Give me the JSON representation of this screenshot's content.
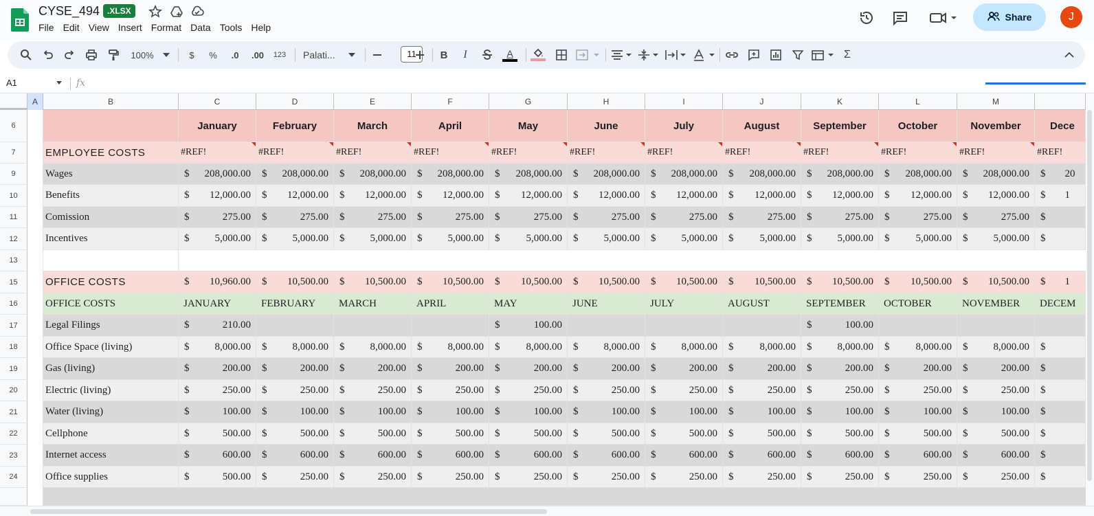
{
  "app": {
    "doc_title": "CYSE_494",
    "format_badge": ".XLSX",
    "menu": [
      "File",
      "Edit",
      "View",
      "Insert",
      "Format",
      "Data",
      "Tools",
      "Help"
    ],
    "share_label": "Share",
    "avatar_letter": "J",
    "accent_color": "#188038"
  },
  "toolbar": {
    "zoom": "100%",
    "currency": "$",
    "percent": "%",
    "dec_decrease": ".0",
    "dec_increase": ".00",
    "number_format": "123",
    "font": "Palati...",
    "font_size": "11",
    "bold": "B",
    "italic": "I",
    "text_color": "A",
    "sigma": "Σ"
  },
  "formula_bar": {
    "cell_ref": "A1",
    "fx": "fx"
  },
  "grid": {
    "columns": [
      "A",
      "B",
      "C",
      "D",
      "E",
      "F",
      "G",
      "H",
      "I",
      "J",
      "K",
      "L",
      "M"
    ],
    "rows": [
      {
        "num": "6",
        "type": "months",
        "label": "",
        "values": [
          "January",
          "February",
          "March",
          "April",
          "May",
          "June",
          "July",
          "August",
          "September",
          "October",
          "November",
          "Dece"
        ]
      },
      {
        "num": "7",
        "type": "ref",
        "label": "EMPLOYEE COSTS",
        "values": [
          "#REF!",
          "#REF!",
          "#REF!",
          "#REF!",
          "#REF!",
          "#REF!",
          "#REF!",
          "#REF!",
          "#REF!",
          "#REF!",
          "#REF!",
          "#REF!"
        ]
      },
      {
        "num": "9",
        "type": "money",
        "style": "gray",
        "label": "Wages",
        "values": [
          "208,000.00",
          "208,000.00",
          "208,000.00",
          "208,000.00",
          "208,000.00",
          "208,000.00",
          "208,000.00",
          "208,000.00",
          "208,000.00",
          "208,000.00",
          "208,000.00",
          "20"
        ]
      },
      {
        "num": "10",
        "type": "money",
        "style": "light",
        "label": "Benefits",
        "values": [
          "12,000.00",
          "12,000.00",
          "12,000.00",
          "12,000.00",
          "12,000.00",
          "12,000.00",
          "12,000.00",
          "12,000.00",
          "12,000.00",
          "12,000.00",
          "12,000.00",
          "1"
        ]
      },
      {
        "num": "11",
        "type": "money",
        "style": "gray",
        "label": "Comission",
        "values": [
          "275.00",
          "275.00",
          "275.00",
          "275.00",
          "275.00",
          "275.00",
          "275.00",
          "275.00",
          "275.00",
          "275.00",
          "275.00",
          ""
        ]
      },
      {
        "num": "12",
        "type": "money",
        "style": "light",
        "label": "Incentives",
        "values": [
          "5,000.00",
          "5,000.00",
          "5,000.00",
          "5,000.00",
          "5,000.00",
          "5,000.00",
          "5,000.00",
          "5,000.00",
          "5,000.00",
          "5,000.00",
          "5,000.00",
          ""
        ]
      },
      {
        "num": "13",
        "type": "blank",
        "label": "",
        "values": []
      },
      {
        "num": "15",
        "type": "money",
        "style": "pink",
        "label": "OFFICE COSTS",
        "values": [
          "10,960.00",
          "10,500.00",
          "10,500.00",
          "10,500.00",
          "10,500.00",
          "10,500.00",
          "10,500.00",
          "10,500.00",
          "10,500.00",
          "10,500.00",
          "10,500.00",
          "1"
        ]
      },
      {
        "num": "16",
        "type": "upper",
        "label": "OFFICE COSTS",
        "values": [
          "JANUARY",
          "FEBRUARY",
          "MARCH",
          "APRIL",
          "MAY",
          "JUNE",
          "JULY",
          "AUGUST",
          "SEPTEMBER",
          "OCTOBER",
          "NOVEMBER",
          "DECEM"
        ]
      },
      {
        "num": "17",
        "type": "money",
        "style": "gray",
        "label": "Legal Filings",
        "values": [
          "210.00",
          null,
          null,
          null,
          "100.00",
          null,
          null,
          null,
          "100.00",
          null,
          null,
          null
        ]
      },
      {
        "num": "18",
        "type": "money",
        "style": "light",
        "label": "Office Space (living)",
        "values": [
          "8,000.00",
          "8,000.00",
          "8,000.00",
          "8,000.00",
          "8,000.00",
          "8,000.00",
          "8,000.00",
          "8,000.00",
          "8,000.00",
          "8,000.00",
          "8,000.00",
          ""
        ]
      },
      {
        "num": "19",
        "type": "money",
        "style": "gray",
        "label": "Gas (living)",
        "values": [
          "200.00",
          "200.00",
          "200.00",
          "200.00",
          "200.00",
          "200.00",
          "200.00",
          "200.00",
          "200.00",
          "200.00",
          "200.00",
          ""
        ]
      },
      {
        "num": "20",
        "type": "money",
        "style": "light",
        "label": "Electric (living)",
        "values": [
          "250.00",
          "250.00",
          "250.00",
          "250.00",
          "250.00",
          "250.00",
          "250.00",
          "250.00",
          "250.00",
          "250.00",
          "250.00",
          ""
        ]
      },
      {
        "num": "21",
        "type": "money",
        "style": "gray",
        "label": "Water (living)",
        "values": [
          "100.00",
          "100.00",
          "100.00",
          "100.00",
          "100.00",
          "100.00",
          "100.00",
          "100.00",
          "100.00",
          "100.00",
          "100.00",
          ""
        ]
      },
      {
        "num": "22",
        "type": "money",
        "style": "light",
        "label": "Cellphone",
        "values": [
          "500.00",
          "500.00",
          "500.00",
          "500.00",
          "500.00",
          "500.00",
          "500.00",
          "500.00",
          "500.00",
          "500.00",
          "500.00",
          ""
        ]
      },
      {
        "num": "23",
        "type": "money",
        "style": "gray",
        "label": "Internet access",
        "values": [
          "600.00",
          "600.00",
          "600.00",
          "600.00",
          "600.00",
          "600.00",
          "600.00",
          "600.00",
          "600.00",
          "600.00",
          "600.00",
          ""
        ]
      },
      {
        "num": "24",
        "type": "money",
        "style": "light",
        "label": "Office supplies",
        "values": [
          "500.00",
          "250.00",
          "250.00",
          "250.00",
          "250.00",
          "250.00",
          "250.00",
          "250.00",
          "250.00",
          "250.00",
          "250.00",
          ""
        ]
      }
    ]
  }
}
